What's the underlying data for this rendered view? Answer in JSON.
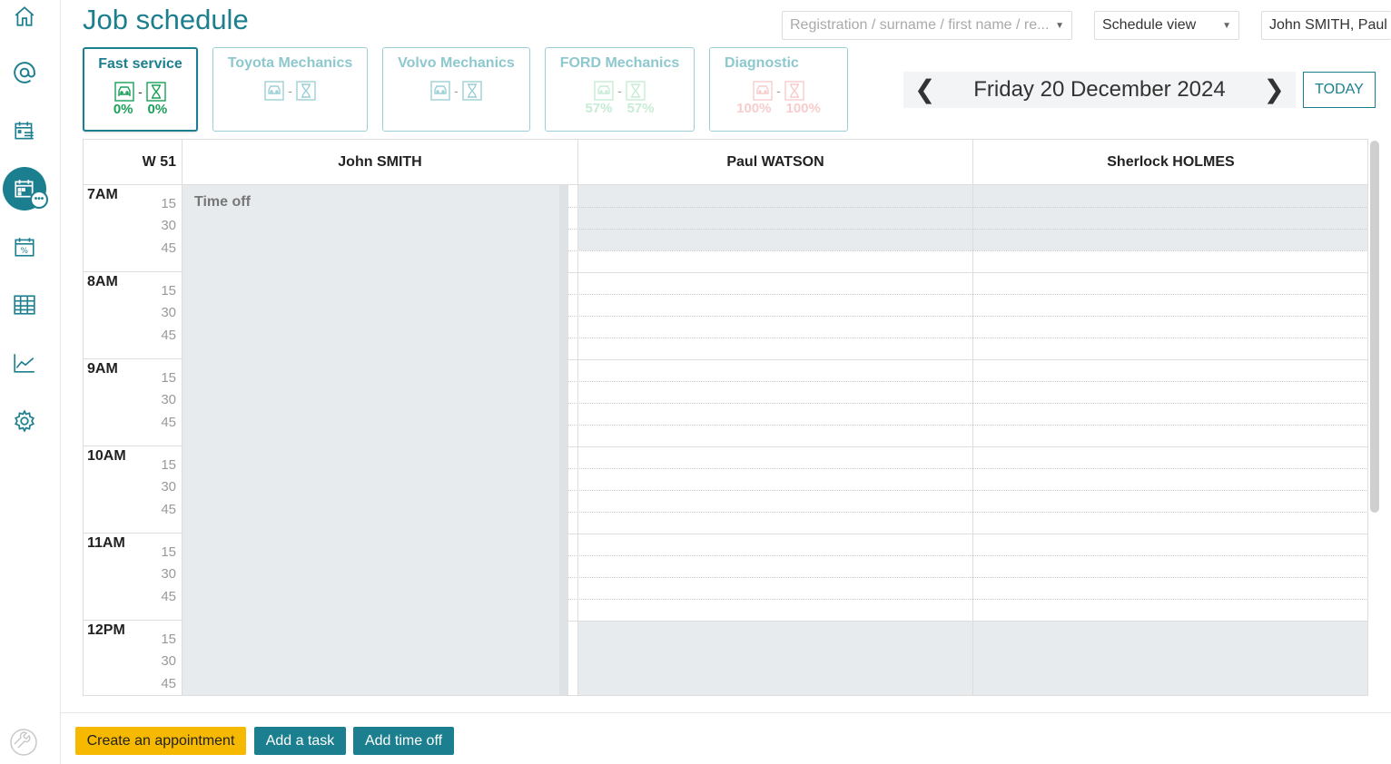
{
  "page_title": "Job schedule",
  "search": {
    "placeholder": "Registration / surname / first name / re..."
  },
  "view_select": {
    "value": "Schedule view"
  },
  "user_select": {
    "value": "John SMITH, Paul"
  },
  "nav_icons": [
    "home-icon",
    "at-icon",
    "calendar-list-icon",
    "calendar-more-icon",
    "calendar-percent-icon",
    "table-icon",
    "chart-line-icon",
    "gear-icon"
  ],
  "teams": [
    {
      "name": "Fast service",
      "pct1": "0%",
      "pct2": "0%"
    },
    {
      "name": "Toyota Mechanics"
    },
    {
      "name": "Volvo Mechanics"
    },
    {
      "name": "FORD Mechanics",
      "pct1": "57%",
      "pct2": "57%"
    },
    {
      "name": "Diagnostic",
      "pct1": "100%",
      "pct2": "100%"
    }
  ],
  "date_nav": {
    "date": "Friday 20 December 2024",
    "today_label": "TODAY"
  },
  "schedule": {
    "week": "W 51",
    "columns": [
      "John SMITH",
      "Paul WATSON",
      "Sherlock HOLMES"
    ],
    "hours": [
      "7AM",
      "8AM",
      "9AM",
      "10AM",
      "11AM",
      "12PM"
    ],
    "quarters": [
      "15",
      "30",
      "45"
    ],
    "time_off_label": "Time off"
  },
  "footer": {
    "create_label": "Create an appointment",
    "task_label": "Add a task",
    "timeoff_label": "Add time off"
  },
  "colors": {
    "accent": "#1c7f8f",
    "yellow": "#f7b900",
    "green": "#1aa05a"
  }
}
